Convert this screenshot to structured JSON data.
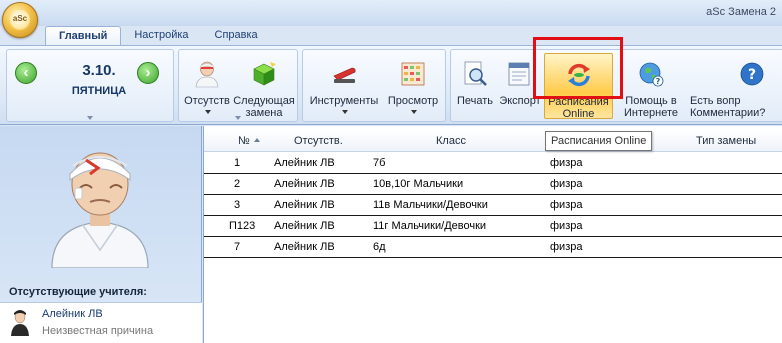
{
  "app": {
    "orb_label": "aSc",
    "title": "aSc Замена 2"
  },
  "tabs": [
    {
      "label": "Главный",
      "active": true
    },
    {
      "label": "Настройка",
      "active": false
    },
    {
      "label": "Справка",
      "active": false
    }
  ],
  "date_nav": {
    "date": "3.10.",
    "day": "ПЯТНИЦА",
    "prev_icon": "arrow-left-icon",
    "next_icon": "arrow-right-icon"
  },
  "ribbon": {
    "absent": {
      "label": "Отсутств",
      "icon": "teacher-bandaged-icon"
    },
    "next_substitution": {
      "label": "Следующая замена",
      "icon": "green-cube-icon"
    },
    "tools": {
      "label": "Инструменты",
      "icon": "stapler-icon"
    },
    "view": {
      "label": "Просмотр",
      "icon": "calendar-grid-icon"
    },
    "print": {
      "label": "Печать",
      "icon": "magnifier-page-icon"
    },
    "export": {
      "label": "Экспорт",
      "icon": "export-icon"
    },
    "timetables_online": {
      "label": "Расписания Online",
      "icon": "sync-arrows-icon"
    },
    "help_internet": {
      "label": "Помощь в Интернете",
      "icon": "globe-question-icon"
    },
    "questions": {
      "label": "Есть вопр Комментарии?",
      "icon": "question-icon"
    }
  },
  "tooltip": "Расписания Online",
  "left_panel": {
    "absent_title": "Отсутствующие учителя:",
    "absent_teachers": [
      {
        "name": "Алейник ЛВ",
        "reason": "Неизвестная причина"
      }
    ]
  },
  "grid": {
    "columns": [
      "№",
      "Отсутств.",
      "Класс",
      "Тип замены"
    ],
    "rows": [
      {
        "num": "1",
        "absent": "Алейник ЛВ",
        "class": "7б",
        "subject": "физра"
      },
      {
        "num": "2",
        "absent": "Алейник ЛВ",
        "class": "10в,10г Мальчики",
        "subject": "физра"
      },
      {
        "num": "3",
        "absent": "Алейник ЛВ",
        "class": "11в Мальчики/Девочки",
        "subject": "физра"
      },
      {
        "num": "П123",
        "absent": "Алейник ЛВ",
        "class": "11г Мальчики/Девочки",
        "subject": "физра"
      },
      {
        "num": "7",
        "absent": "Алейник ЛВ",
        "class": "6д",
        "subject": "физра"
      }
    ]
  },
  "colors": {
    "highlight_border": "#e10f14",
    "ribbon_bg": "#dce8f6",
    "active_button": "#ffd56b"
  }
}
